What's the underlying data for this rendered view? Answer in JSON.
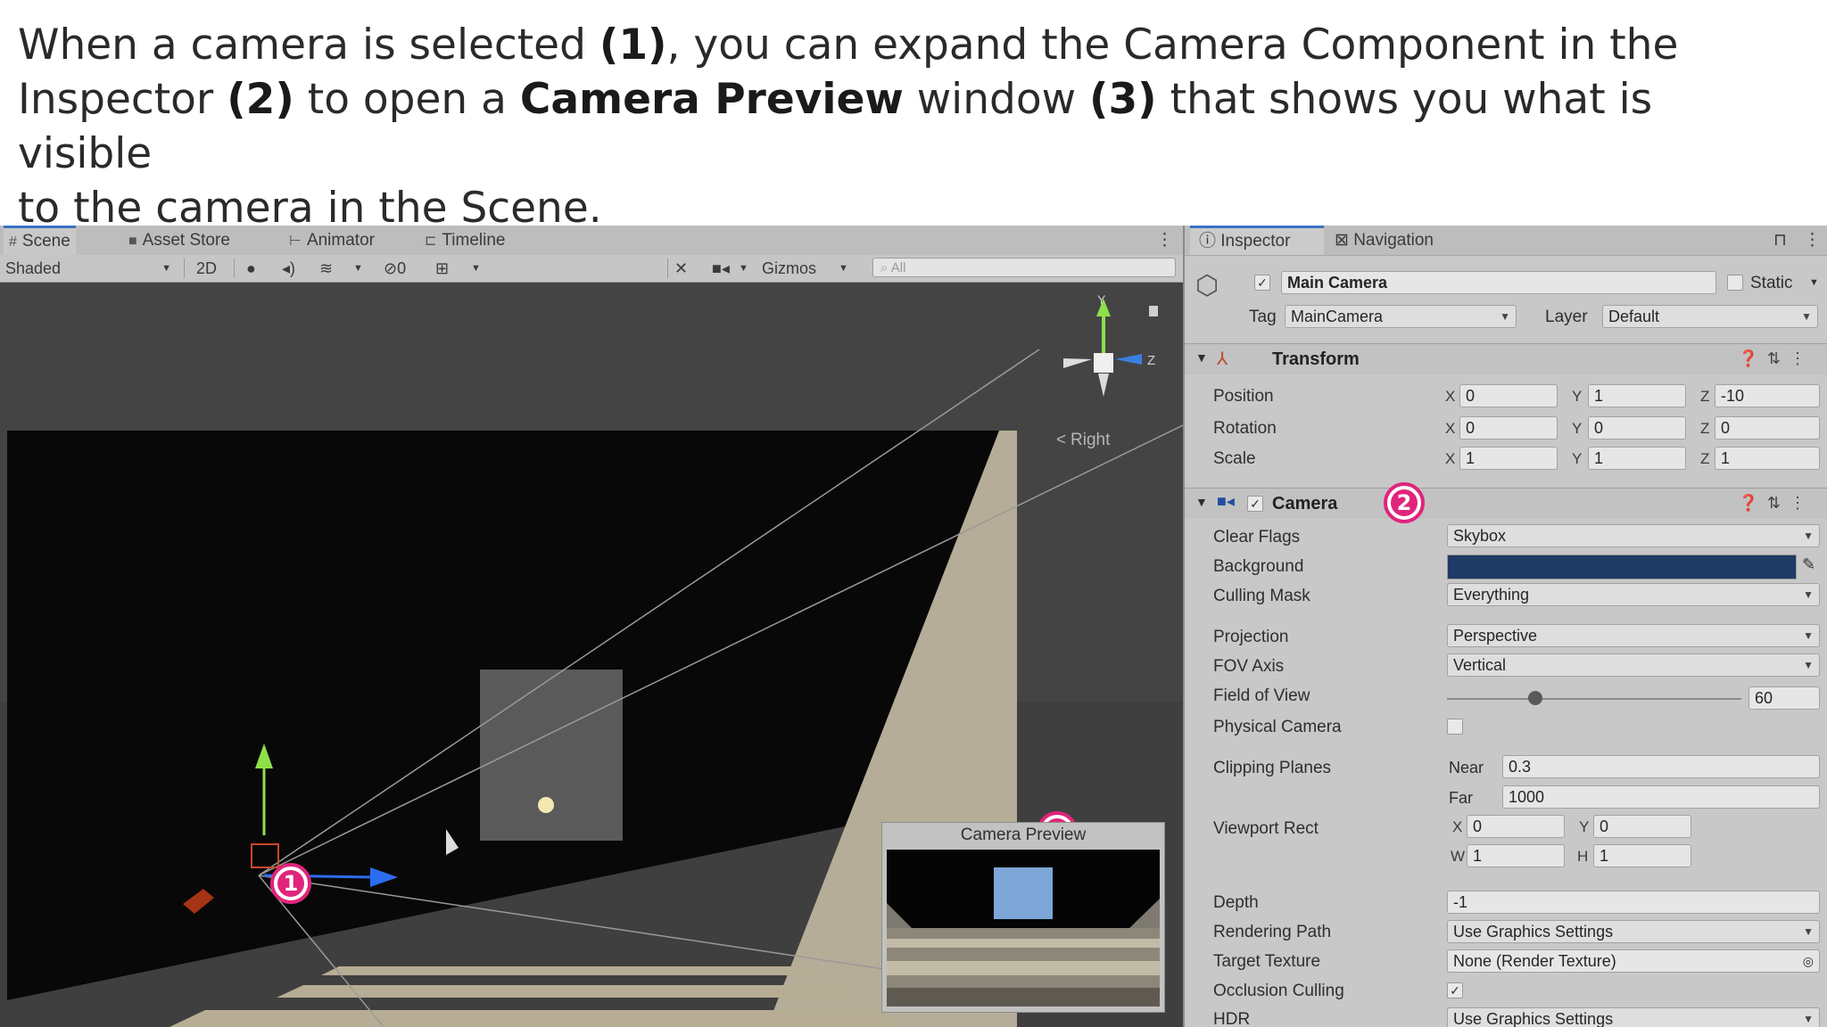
{
  "caption": {
    "line1_a": "When a camera is selected ",
    "line1_b": "(1)",
    "line1_c": ", you can expand the Camera Component in the",
    "line2_a": "Inspector ",
    "line2_b": "(2)",
    "line2_c": " to open a ",
    "line2_d": "Camera Preview",
    "line2_e": " window ",
    "line2_f": "(3)",
    "line2_g": " that shows you what is visible",
    "line3": "to the camera in the Scene."
  },
  "scene": {
    "tabs": [
      "Scene",
      "Asset Store",
      "Animator",
      "Timeline"
    ],
    "shading": "Shaded",
    "mode_2d": "2D",
    "hidden_count": "0",
    "gizmos": "Gizmos",
    "search_placeholder": "All",
    "orientation_label": "Right",
    "gizmo_z": "Z",
    "gizmo_y": "Y",
    "camera_preview_title": "Camera Preview"
  },
  "badges": [
    "1",
    "2",
    "3"
  ],
  "inspector": {
    "tabs": [
      "Inspector",
      "Navigation"
    ],
    "object_name": "Main Camera",
    "static_label": "Static",
    "tag_label": "Tag",
    "tag_value": "MainCamera",
    "layer_label": "Layer",
    "layer_value": "Default",
    "transform": {
      "title": "Transform",
      "position_label": "Position",
      "position": [
        "0",
        "1",
        "-10"
      ],
      "rotation_label": "Rotation",
      "rotation": [
        "0",
        "0",
        "0"
      ],
      "scale_label": "Scale",
      "scale": [
        "1",
        "1",
        "1"
      ]
    },
    "camera": {
      "title": "Camera",
      "clear_flags_label": "Clear Flags",
      "clear_flags": "Skybox",
      "background_label": "Background",
      "background_color": "#1f3a64",
      "culling_mask_label": "Culling Mask",
      "culling_mask": "Everything",
      "projection_label": "Projection",
      "projection": "Perspective",
      "fov_axis_label": "FOV Axis",
      "fov_axis": "Vertical",
      "fov_label": "Field of View",
      "fov": "60",
      "fov_fraction": 0.3,
      "physical_label": "Physical Camera",
      "clipping_label": "Clipping Planes",
      "near_label": "Near",
      "near": "0.3",
      "far_label": "Far",
      "far": "1000",
      "viewport_label": "Viewport Rect",
      "vp_x": "0",
      "vp_y": "0",
      "vp_w": "1",
      "vp_h": "1",
      "depth_label": "Depth",
      "depth": "-1",
      "rendering_label": "Rendering Path",
      "rendering": "Use Graphics Settings",
      "target_label": "Target Texture",
      "target": "None (Render Texture)",
      "occlusion_label": "Occlusion Culling",
      "hdr_label": "HDR",
      "hdr": "Use Graphics Settings"
    }
  },
  "colors": {
    "badge": "#e0247c",
    "accent": "#3a72c6"
  }
}
